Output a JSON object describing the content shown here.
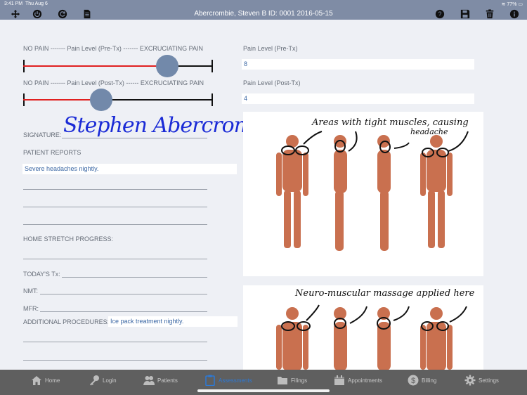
{
  "status": {
    "time": "3:41 PM",
    "date": "Thu Aug 6",
    "battery": "77%"
  },
  "header": {
    "title": "Abercrombie, Steven B   ID: 0001  2016-05-15"
  },
  "toolbar_icons": {
    "left": [
      "move-icon",
      "power-icon",
      "refresh-icon",
      "document-icon"
    ],
    "right": [
      "help-icon",
      "save-icon",
      "trash-icon",
      "info-icon"
    ]
  },
  "pain": {
    "pre": {
      "label": "NO PAIN ------- Pain Level (Pre-Tx) ------- EXCRUCIATING PAIN",
      "value_label": "Pain Level (Pre-Tx)",
      "value": "8",
      "level_fraction": 0.76
    },
    "post": {
      "label": "NO PAIN ------- Pain Level (Post-Tx) ------ EXCRUCIATING PAIN",
      "value_label": "Pain Level (Post-Tx)",
      "value": "4",
      "level_fraction": 0.41
    }
  },
  "form": {
    "signature_label": "SIGNATURE:",
    "signature": "Stephen Abercrombie",
    "patient_reports_label": "PATIENT REPORTS",
    "patient_reports": "Severe headaches nightly.",
    "home_stretch_label": "HOME STRETCH PROGRESS:",
    "todays_tx_label": "TODAY'S Tx:",
    "nmt_label": "NMT:",
    "mfr_label": "MFR:",
    "additional_label": "ADDITIONAL PROCEDURES:",
    "additional_value": "Ice pack treatment nightly."
  },
  "diagrams": {
    "top_note_1": "Areas with tight muscles, causing",
    "top_note_2": "headache",
    "bottom_note": "Neuro-muscular massage applied here"
  },
  "tabs": [
    {
      "label": "Home",
      "icon": "home-icon"
    },
    {
      "label": "Login",
      "icon": "key-icon"
    },
    {
      "label": "Patients",
      "icon": "patients-icon"
    },
    {
      "label": "Assessments",
      "icon": "clipboard-icon"
    },
    {
      "label": "Filings",
      "icon": "folder-icon"
    },
    {
      "label": "Appointments",
      "icon": "calendar-icon"
    },
    {
      "label": "Billing",
      "icon": "dollar-icon"
    },
    {
      "label": "Settings",
      "icon": "gear-icon"
    }
  ],
  "colors": {
    "header_bg": "#7f8ca5",
    "accent": "#2c79d6",
    "slider_fill": "#e02020",
    "thumb": "#7289aa",
    "signature_ink": "#1b2bd6"
  }
}
